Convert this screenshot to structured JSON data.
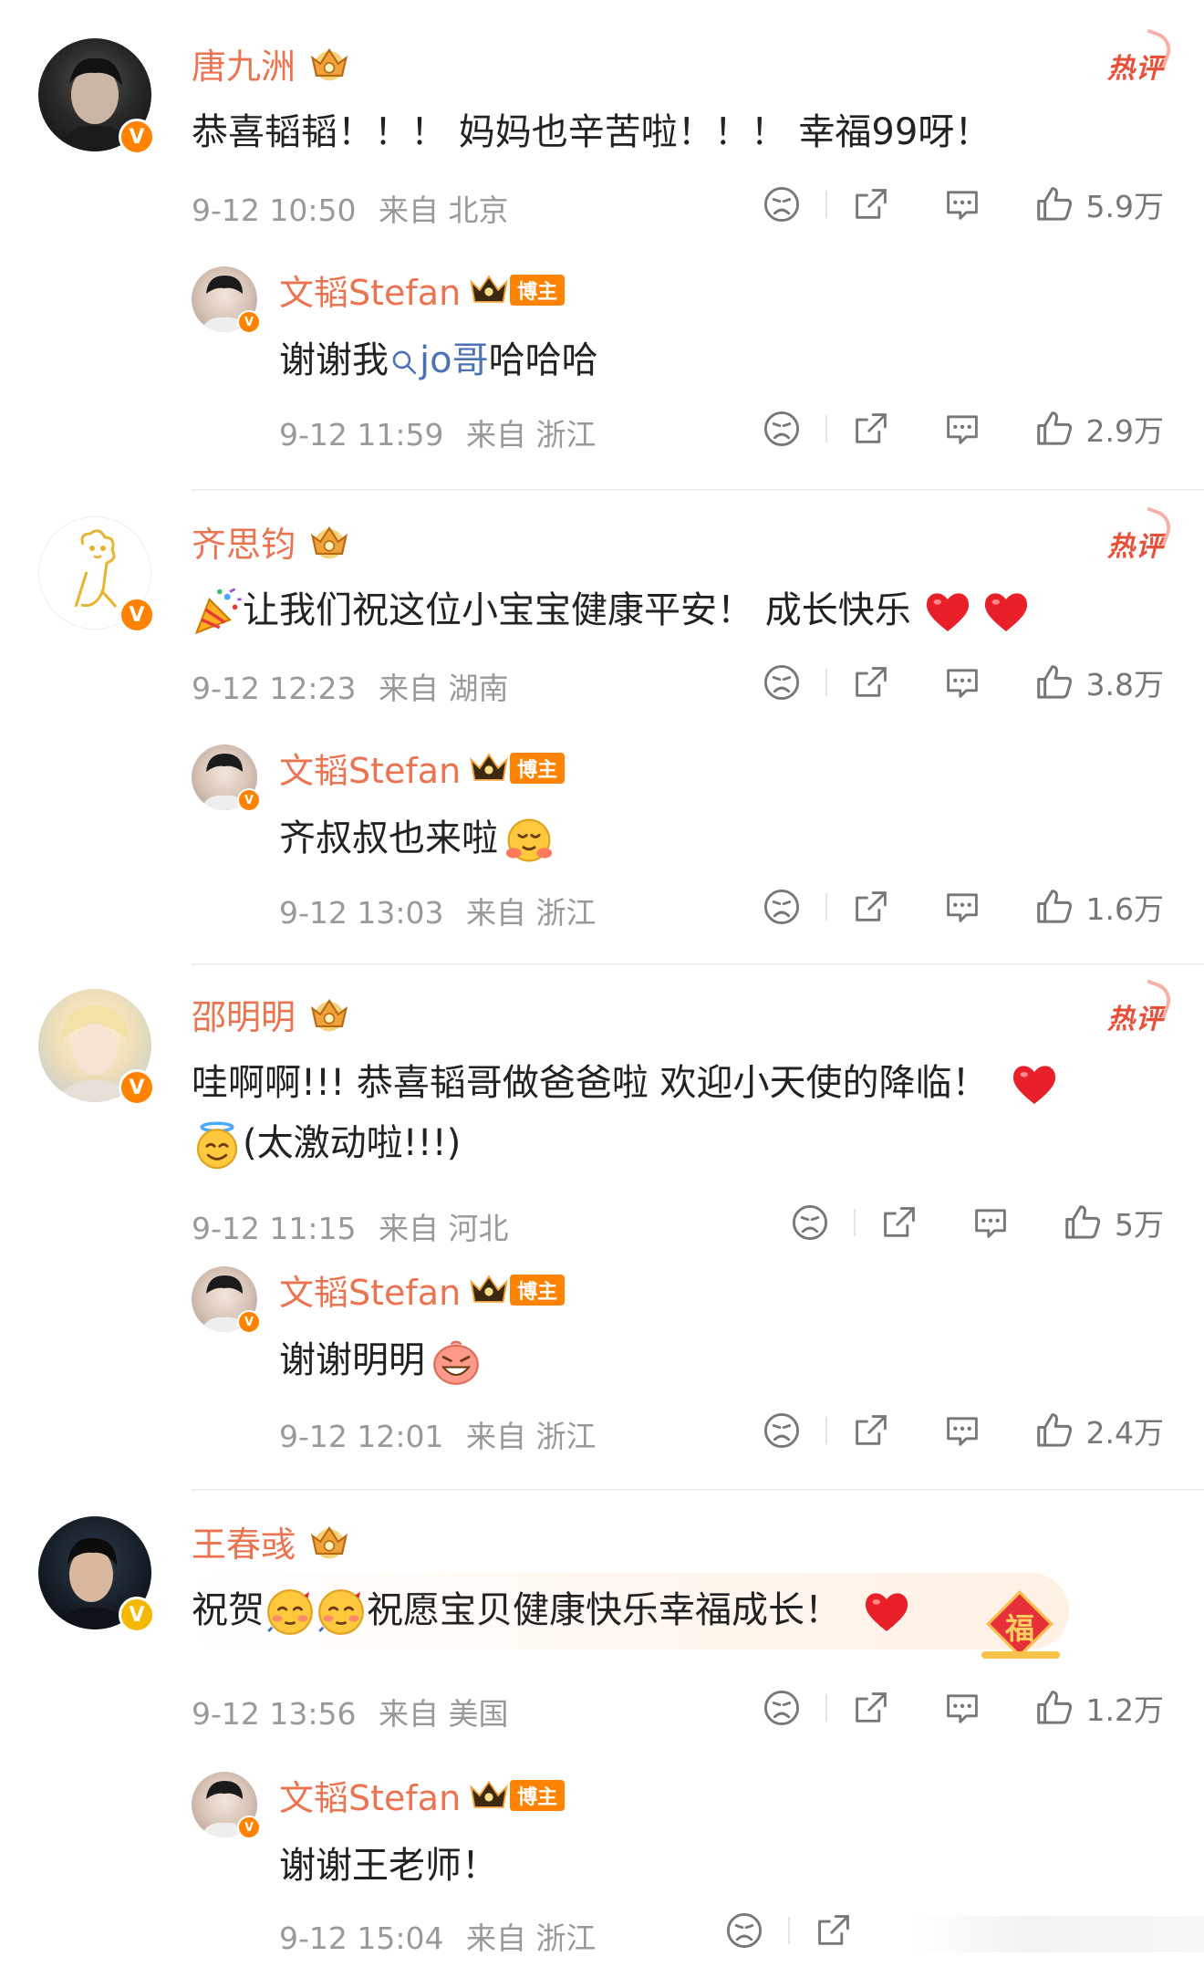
{
  "comments": [
    {
      "user": "唐九洲",
      "hot": "热评",
      "text": "恭喜韬韬！！！ 妈妈也辛苦啦！！！ 幸福99呀！",
      "time": "9-12 10:50",
      "source": "来自 北京",
      "likes": "5.9万",
      "reply": {
        "user": "文韬Stefan",
        "tag": "博主",
        "text_before": "谢谢我",
        "mention": "jo哥",
        "text_after": "哈哈哈",
        "time": "9-12 11:59",
        "source": "来自 浙江",
        "likes": "2.9万"
      }
    },
    {
      "user": "齐思钧",
      "hot": "热评",
      "text": "让我们祝这位小宝宝健康平安！ 成长快乐",
      "time": "9-12 12:23",
      "source": "来自 湖南",
      "likes": "3.8万",
      "reply": {
        "user": "文韬Stefan",
        "tag": "博主",
        "text": "齐叔叔也来啦",
        "time": "9-12 13:03",
        "source": "来自 浙江",
        "likes": "1.6万"
      }
    },
    {
      "user": "邵明明",
      "hot": "热评",
      "text": "哇啊啊!!! 恭喜韬哥做爸爸啦 欢迎小天使的降临！",
      "text2": "(太激动啦!!!)",
      "time": "9-12 11:15",
      "source": "来自 河北",
      "likes": "5万",
      "reply": {
        "user": "文韬Stefan",
        "tag": "博主",
        "text": "谢谢明明",
        "time": "9-12 12:01",
        "source": "来自 浙江",
        "likes": "2.4万"
      }
    },
    {
      "user": "王春彧",
      "text_before": "祝贺",
      "text": "祝愿宝贝健康快乐幸福成长！",
      "fu": "福",
      "time": "9-12 13:56",
      "source": "来自 美国",
      "likes": "1.2万",
      "reply": {
        "user": "文韬Stefan",
        "tag": "博主",
        "text": "谢谢王老师！",
        "time": "9-12 15:04",
        "source": "来自 浙江"
      }
    }
  ],
  "icons": [
    "dislike-icon",
    "share-icon",
    "comment-icon",
    "like-icon",
    "crown-icon",
    "verified-v-icon",
    "search-mention-icon",
    "heart-emoji",
    "party-popper-emoji",
    "hug-emoji",
    "angel-emoji",
    "grin-emoji",
    "smitten-emoji"
  ],
  "colors": {
    "name": "#eb7350",
    "hot": "#e8503a",
    "meta": "#999999",
    "mention": "#4a72b5",
    "verified": "#ff8200"
  }
}
